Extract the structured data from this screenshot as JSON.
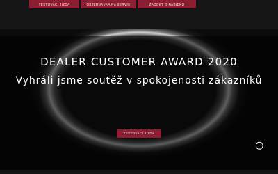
{
  "nav": {
    "buttons": [
      {
        "label": "TESTOVACÍ JÍZDA"
      },
      {
        "label": "OBJEDNÁVKA NA SERVIS"
      },
      {
        "label": "ŽÁDOST O NABÍDKU"
      }
    ]
  },
  "hero": {
    "title": "DEALER CUSTOMER AWARD 2020",
    "subtitle": "Vyhráli jsme soutěž v spokojenosti zákazníků",
    "cta_label": "TESTOVACÍ JÍZDA"
  },
  "icons": {
    "replay": "replay-icon"
  },
  "colors": {
    "accent": "#8c1d33",
    "background": "#0b0b0b",
    "text": "#ffffff"
  }
}
